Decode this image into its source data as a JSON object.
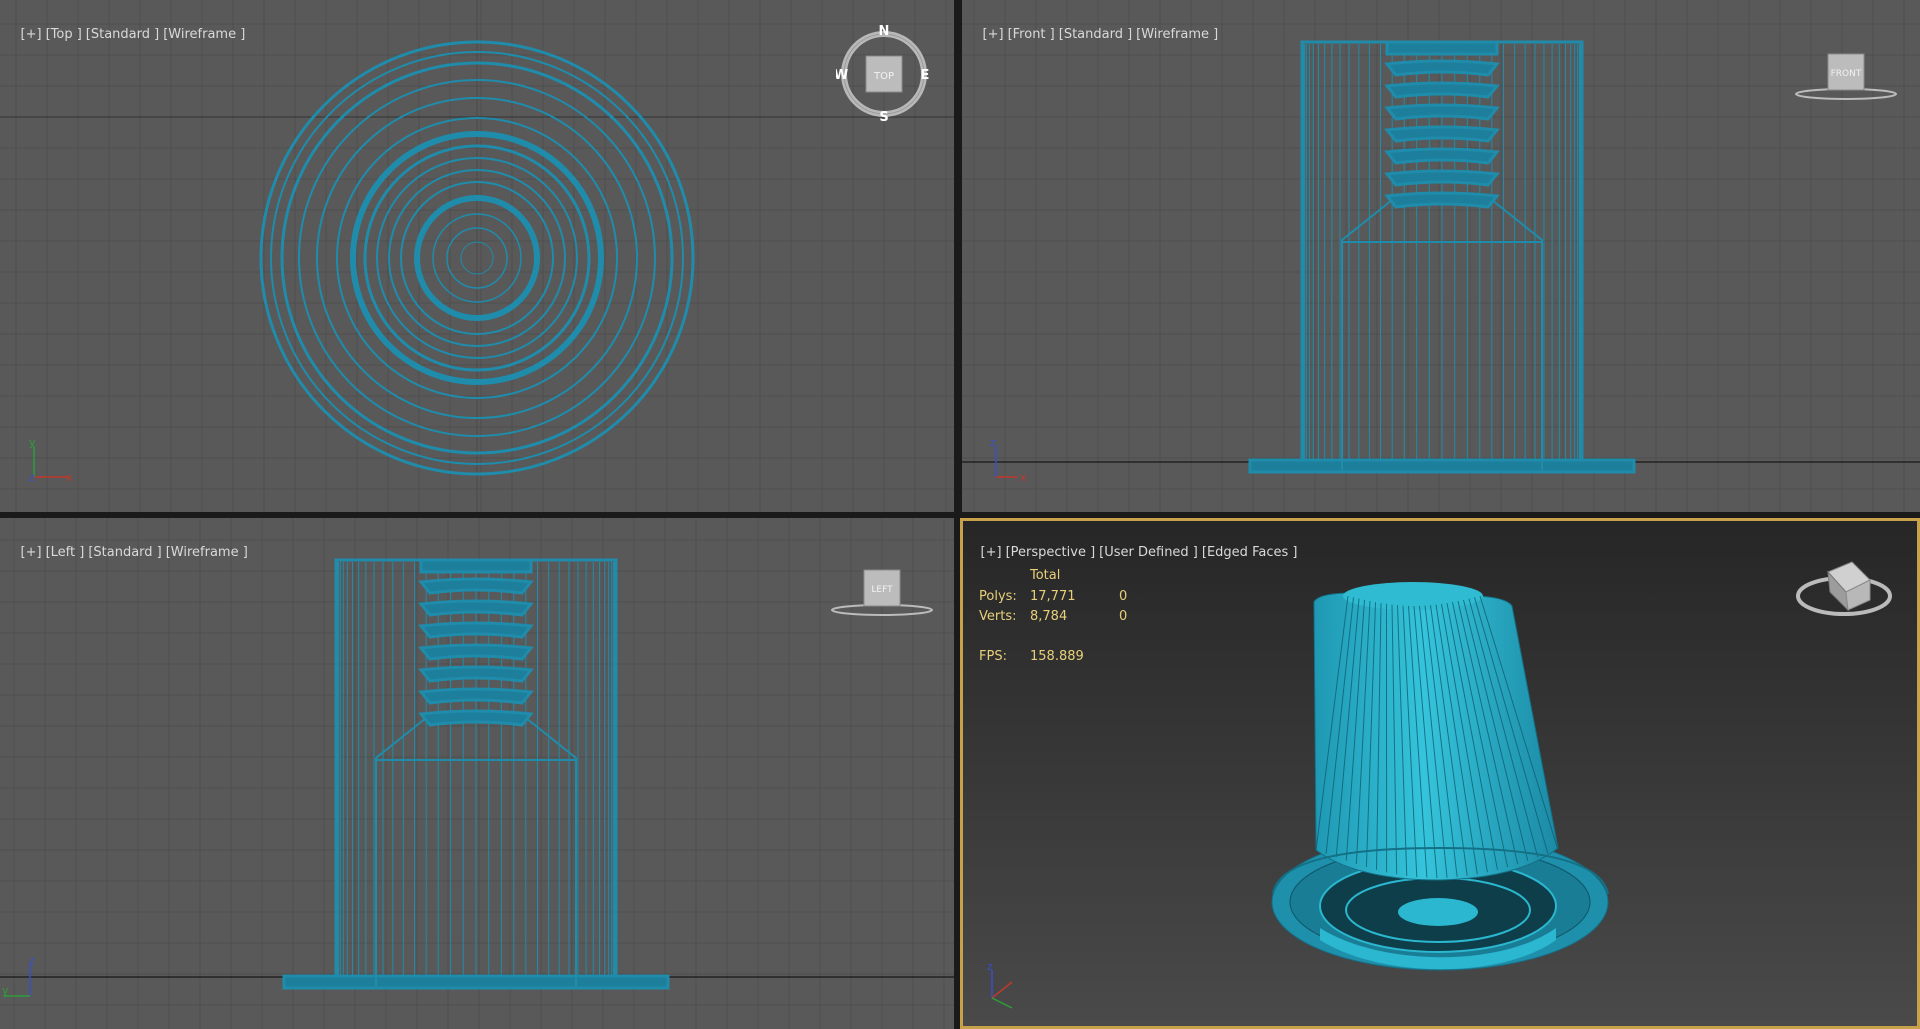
{
  "viewports": {
    "top": {
      "labels": [
        "[+]",
        "[Top ]",
        "[Standard ]",
        "[Wireframe ]"
      ]
    },
    "front": {
      "labels": [
        "[+]",
        "[Front ]",
        "[Standard ]",
        "[Wireframe ]"
      ]
    },
    "left": {
      "labels": [
        "[+]",
        "[Left ]",
        "[Standard ]",
        "[Wireframe ]"
      ]
    },
    "perspective": {
      "labels": [
        "[+]",
        "[Perspective ]",
        "[User Defined ]",
        "[Edged Faces ]"
      ]
    }
  },
  "compass": {
    "n": "N",
    "s": "S",
    "e": "E",
    "w": "W"
  },
  "viewcube": {
    "top": "TOP",
    "front": "FRONT",
    "left": "LEFT"
  },
  "axes": {
    "x": "x",
    "y": "y",
    "z": "z"
  },
  "stats": {
    "header": "Total",
    "polys_label": "Polys:",
    "polys_value": "17,771",
    "polys_sel": "0",
    "verts_label": "Verts:",
    "verts_value": "8,784",
    "verts_sel": "0",
    "fps_label": "FPS:",
    "fps_value": "158.889"
  },
  "colors": {
    "viewport_bg": "#595959",
    "grid": "#4d4d4d",
    "wire": "#1e8fae",
    "mesh": "#2ab7cf",
    "active_border": "#c8a24a",
    "stats_text": "#e8d07a"
  }
}
